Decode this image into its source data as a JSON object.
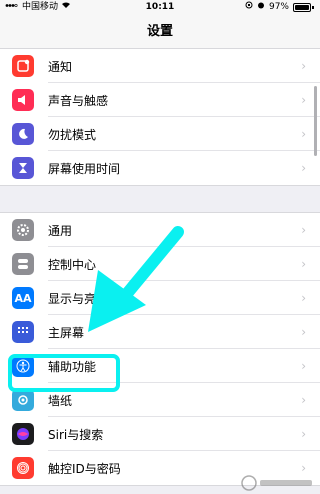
{
  "status_bar": {
    "carrier": "中国移动",
    "time": "10:11",
    "battery": "97%",
    "battery_level": 0.97
  },
  "nav": {
    "title": "设置"
  },
  "groups": [
    [
      {
        "label": "通知",
        "icon": "notification-icon",
        "color": "#ff3b30"
      },
      {
        "label": "声音与触感",
        "icon": "sound-icon",
        "color": "#ff2d55"
      },
      {
        "label": "勿扰模式",
        "icon": "moon-icon",
        "color": "#5856d6"
      },
      {
        "label": "屏幕使用时间",
        "icon": "hourglass-icon",
        "color": "#5856d6"
      }
    ],
    [
      {
        "label": "通用",
        "icon": "gear-icon",
        "color": "#8e8e93"
      },
      {
        "label": "控制中心",
        "icon": "toggle-icon",
        "color": "#8e8e93"
      },
      {
        "label": "显示与亮",
        "icon": "display-icon",
        "color": "#007aff",
        "icon_text": "AA"
      },
      {
        "label": "主屏幕",
        "icon": "home-grid-icon",
        "color": "#3a5bd9"
      },
      {
        "label": "辅助功能",
        "icon": "accessibility-icon",
        "color": "#007aff"
      },
      {
        "label": "墙纸",
        "icon": "wallpaper-icon",
        "color": "#34aadc"
      },
      {
        "label": "Siri与搜索",
        "icon": "siri-icon",
        "color": "#1c1c1e"
      },
      {
        "label": "触控ID与密码",
        "icon": "fingerprint-icon",
        "color": "#ff3b30"
      }
    ]
  ],
  "colors": {
    "annotation": "#0af0f0"
  }
}
